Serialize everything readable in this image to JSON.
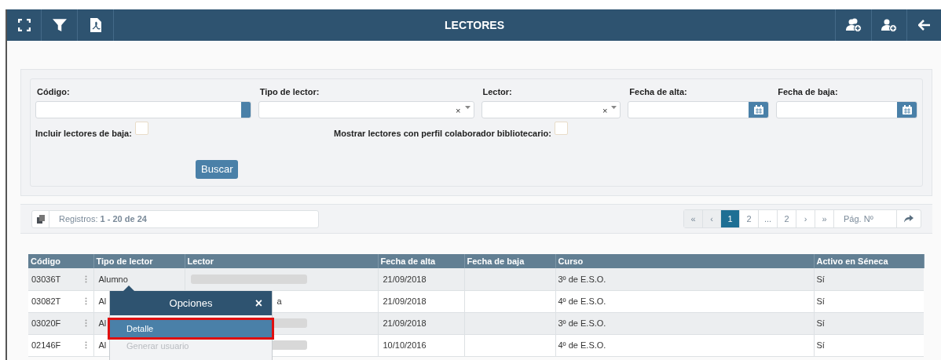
{
  "header": {
    "title": "LECTORES"
  },
  "filters": {
    "fields": [
      {
        "label": "Código:",
        "kind": "text"
      },
      {
        "label": "Tipo de lector:",
        "kind": "select",
        "clear": "×"
      },
      {
        "label": "Lector:",
        "kind": "select",
        "clear": "×"
      },
      {
        "label": "Fecha de alta:",
        "kind": "date"
      },
      {
        "label": "Fecha de baja:",
        "kind": "date"
      }
    ],
    "checkboxes": [
      {
        "label": "Incluir lectores de baja:",
        "checked": false
      },
      {
        "label": "Mostrar lectores con perfil colaborador bibliotecario:",
        "checked": false
      }
    ],
    "search_button": "Buscar"
  },
  "records": {
    "label": "Registros:",
    "range": "1 - 20 de 24"
  },
  "pagination": {
    "first": "«",
    "prev": "‹",
    "pages": [
      {
        "label": "1",
        "selected": true
      },
      {
        "label": "2",
        "selected": false
      },
      {
        "label": "...",
        "selected": false
      },
      {
        "label": "2",
        "selected": false
      }
    ],
    "next": "›",
    "last": "»",
    "page_input_placeholder": "Pág. Nº"
  },
  "table": {
    "columns": [
      "Código",
      "Tipo de lector",
      "Lector",
      "Fecha de alta",
      "Fecha de baja",
      "Curso",
      "Activo en Séneca"
    ],
    "rows": [
      {
        "codigo": "03036T",
        "tipo": "Alumno",
        "lector": {
          "kind": "redacted"
        },
        "fecha_alta": "21/09/2018",
        "curso": "3º de E.S.O.",
        "activo": "Sí"
      },
      {
        "codigo": "03082T",
        "tipo": "Al",
        "lector": {
          "kind": "text",
          "text": "a"
        },
        "fecha_alta": "21/09/2018",
        "curso": "4º de E.S.O.",
        "activo": "Sí"
      },
      {
        "codigo": "03020F",
        "tipo": "Al",
        "lector": {
          "kind": "redacted"
        },
        "fecha_alta": "21/09/2018",
        "curso": "3º de E.S.O.",
        "activo": "Sí"
      },
      {
        "codigo": "02146F",
        "tipo": "Al",
        "lector": {
          "kind": "redacted"
        },
        "fecha_alta": "10/10/2016",
        "curso": "4º de E.S.O.",
        "activo": "Sí"
      }
    ]
  },
  "options_popup": {
    "title": "Opciones",
    "close": "×",
    "items": [
      {
        "label": "Detalle",
        "selected": true,
        "disabled": false
      },
      {
        "label": "Generar usuario",
        "selected": false,
        "disabled": true
      }
    ]
  }
}
